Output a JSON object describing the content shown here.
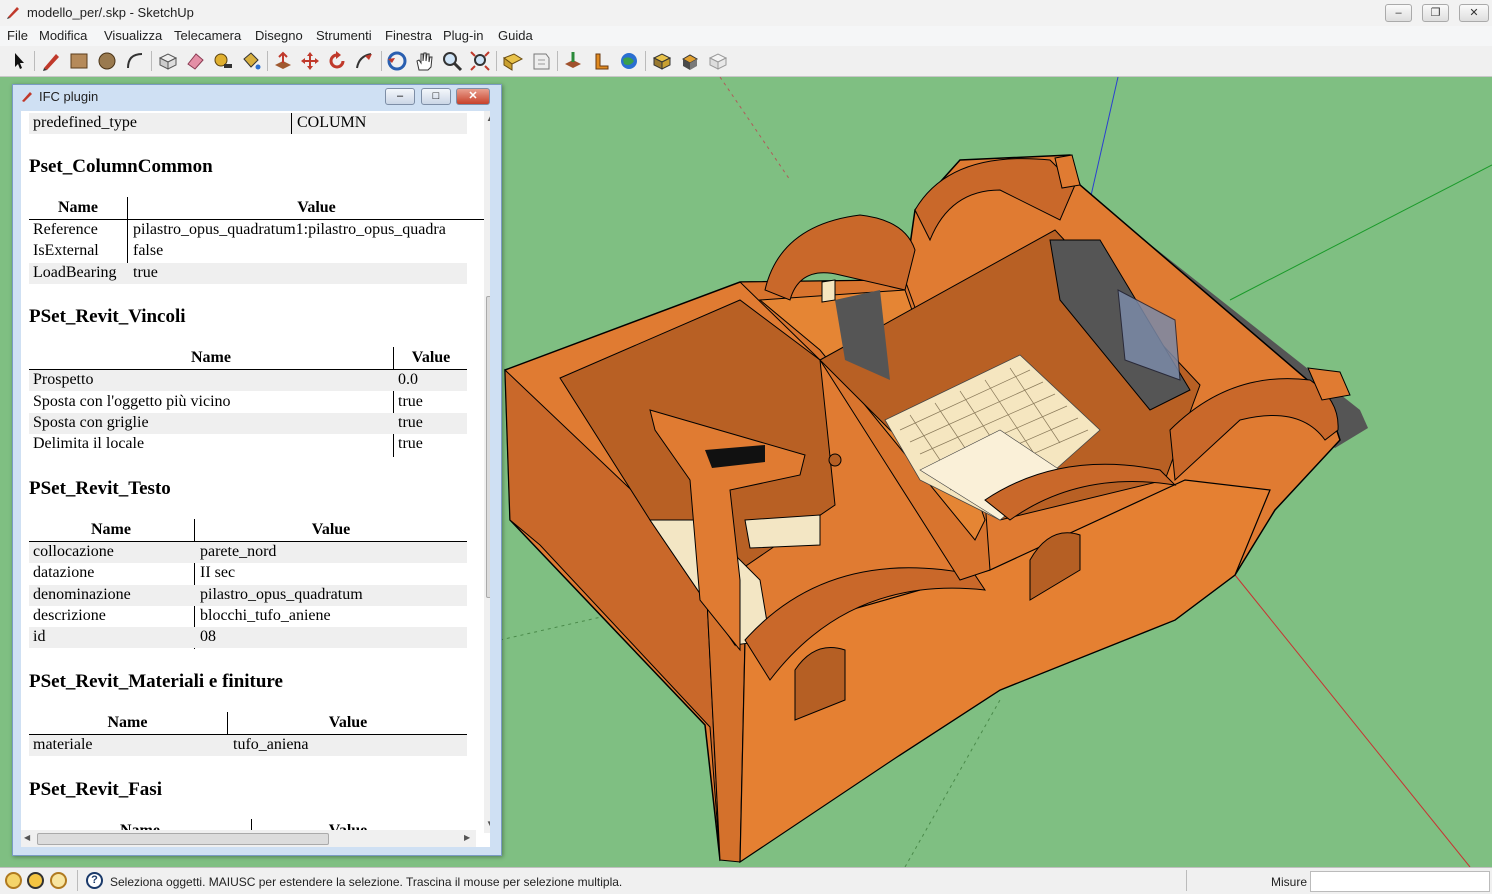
{
  "window": {
    "title": "modello_per/.skp - SketchUp"
  },
  "menu": [
    "File",
    "Modifica",
    "Visualizza",
    "Telecamera",
    "Disegno",
    "Strumenti",
    "Finestra",
    "Plug-in",
    "Guida"
  ],
  "toolbar": [
    "select-icon",
    "pencil-icon",
    "rectangle-icon",
    "circle-icon",
    "arc-icon",
    "make-component-icon",
    "eraser-icon",
    "tape-measure-icon",
    "paint-bucket-icon",
    "push-pull-icon",
    "move-icon",
    "rotate-icon",
    "follow-me-icon",
    "orbit-icon",
    "pan-icon",
    "zoom-icon",
    "zoom-extents-icon",
    "get-models-icon",
    "share-model-icon",
    "ifc-export-icon",
    "ifc-import-icon",
    "geolocation-icon",
    "component-warehouse-icon",
    "extension-icon",
    "share-component-icon"
  ],
  "ifc_panel": {
    "title": "IFC plugin",
    "predefined_type": {
      "name": "predefined_type",
      "value": "COLUMN"
    },
    "col_name": "Name",
    "col_value": "Value",
    "psets": [
      {
        "title": "Pset_ColumnCommon",
        "rows": [
          [
            "Reference",
            "pilastro_opus_quadratum1:pilastro_opus_quadra"
          ],
          [
            "IsExternal",
            "false"
          ],
          [
            "LoadBearing",
            "true"
          ]
        ]
      },
      {
        "title": "PSet_Revit_Vincoli",
        "rows": [
          [
            "Prospetto",
            "0.0"
          ],
          [
            "Sposta con l'oggetto più vicino",
            "true"
          ],
          [
            "Sposta con griglie",
            "true"
          ],
          [
            "Delimita il locale",
            "true"
          ]
        ]
      },
      {
        "title": "PSet_Revit_Testo",
        "rows": [
          [
            "collocazione",
            "parete_nord"
          ],
          [
            "datazione",
            "II sec"
          ],
          [
            "denominazione",
            "pilastro_opus_quadratum"
          ],
          [
            "descrizione",
            "blocchi_tufo_aniene"
          ],
          [
            "id",
            "08"
          ]
        ]
      },
      {
        "title": "PSet_Revit_Materiali e finiture",
        "rows": [
          [
            "materiale",
            "tufo_aniena"
          ]
        ]
      },
      {
        "title": "PSet_Revit_Fasi",
        "rows": []
      }
    ]
  },
  "status": {
    "text": "Seleziona oggetti. MAIUSC per estendere la selezione. Trascina il mouse per selezione multipla.",
    "measure_label": "Misure"
  },
  "colors": {
    "model": "#e07b32",
    "model_dark": "#b35d20",
    "ground": "#7fbf82",
    "floor": "#f5e6c0"
  }
}
